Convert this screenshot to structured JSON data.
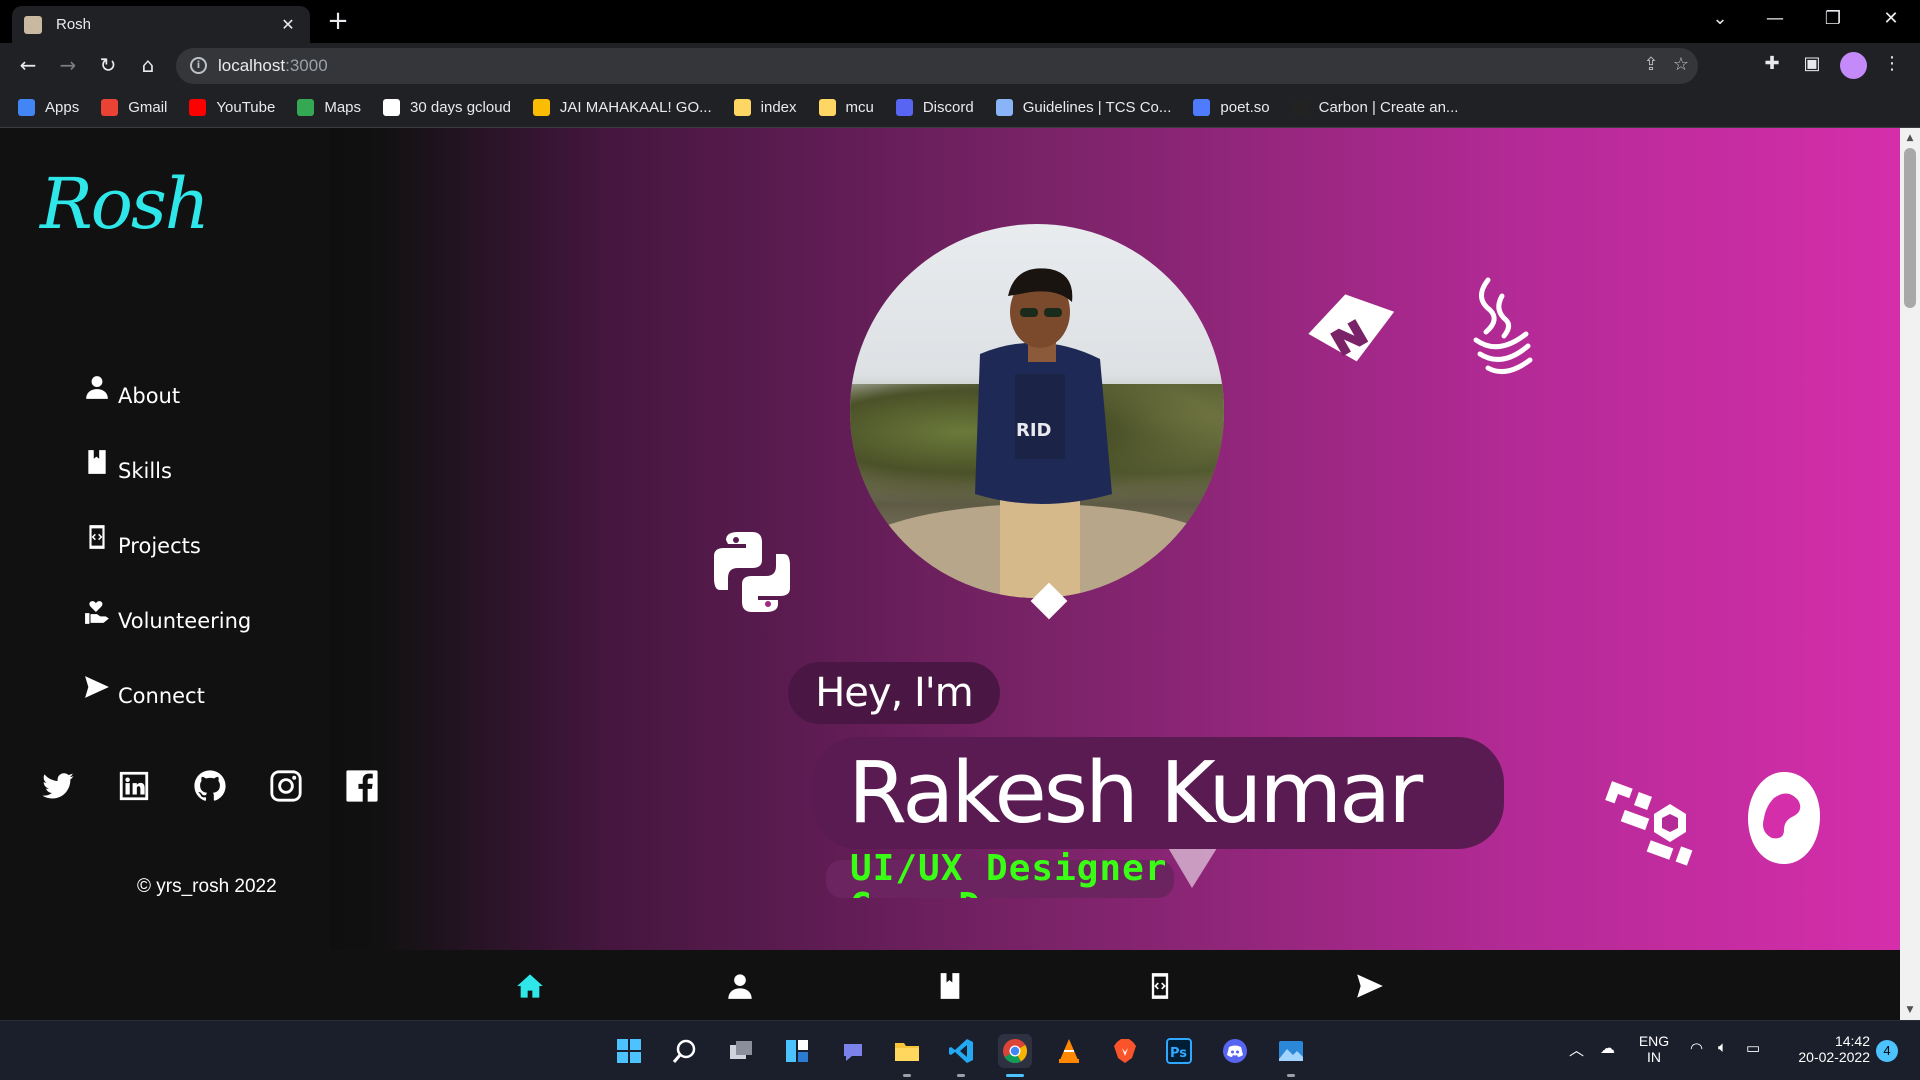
{
  "browser": {
    "tab_title": "Rosh",
    "url_host": "localhost",
    "url_port": ":3000",
    "bookmarks": [
      {
        "label": "Apps",
        "icon": "apps-grid-icon",
        "color": "#4285f4"
      },
      {
        "label": "Gmail",
        "icon": "gmail-icon",
        "color": "#ea4335"
      },
      {
        "label": "YouTube",
        "icon": "youtube-icon",
        "color": "#ff0000"
      },
      {
        "label": "Maps",
        "icon": "maps-icon",
        "color": "#34a853"
      },
      {
        "label": "30 days gcloud",
        "icon": "google-icon",
        "color": "#ffffff"
      },
      {
        "label": "JAI MAHAKAAL! GO...",
        "icon": "drive-icon",
        "color": "#fbbc04"
      },
      {
        "label": "index",
        "icon": "folder-icon",
        "color": "#fdd663"
      },
      {
        "label": "mcu",
        "icon": "folder-icon",
        "color": "#fdd663"
      },
      {
        "label": "Discord",
        "icon": "discord-icon",
        "color": "#5865f2"
      },
      {
        "label": "Guidelines | TCS Co...",
        "icon": "page-icon",
        "color": "#8ab4f8"
      },
      {
        "label": "poet.so",
        "icon": "poet-icon",
        "color": "#4f7cff"
      },
      {
        "label": "Carbon | Create an...",
        "icon": "carbon-icon",
        "color": "#222222"
      }
    ]
  },
  "site": {
    "logo": "Rosh",
    "nav": [
      {
        "label": "About",
        "icon": "user-icon"
      },
      {
        "label": "Skills",
        "icon": "book-icon"
      },
      {
        "label": "Projects",
        "icon": "code-icon"
      },
      {
        "label": "Volunteering",
        "icon": "hand-heart-icon"
      },
      {
        "label": "Connect",
        "icon": "send-icon"
      }
    ],
    "social": [
      "twitter-icon",
      "linkedin-icon",
      "github-icon",
      "instagram-icon",
      "facebook-icon"
    ],
    "copyright": "© yrs_rosh 2022",
    "greeting": "Hey, I'm",
    "name": "Rakesh Kumar",
    "role_current": "UI/UX Designer",
    "role_next": "Game Dev",
    "accent_color": "#2fe7e9",
    "role_color": "#39ff14",
    "bottom_nav": [
      "home-icon",
      "user-icon",
      "book-icon",
      "code-icon",
      "send-icon"
    ],
    "bottom_nav_active": "home-icon",
    "floating_icons": [
      "unreal-engine-icon",
      "java-icon",
      "python-icon",
      "sass-icon",
      "nodejs-icon",
      "ubuntu-icon"
    ]
  },
  "taskbar": {
    "apps": [
      "start-icon",
      "search-icon",
      "task-view-icon",
      "widgets-icon",
      "teams-chat-icon",
      "file-explorer-icon",
      "vscode-icon",
      "chrome-icon",
      "vlc-icon",
      "brave-icon",
      "photoshop-icon",
      "discord-icon",
      "photos-icon"
    ],
    "active_app": "chrome-icon",
    "lang_top": "ENG",
    "lang_bottom": "IN",
    "time": "14:42",
    "date": "20-02-2022",
    "notifications": "4"
  }
}
